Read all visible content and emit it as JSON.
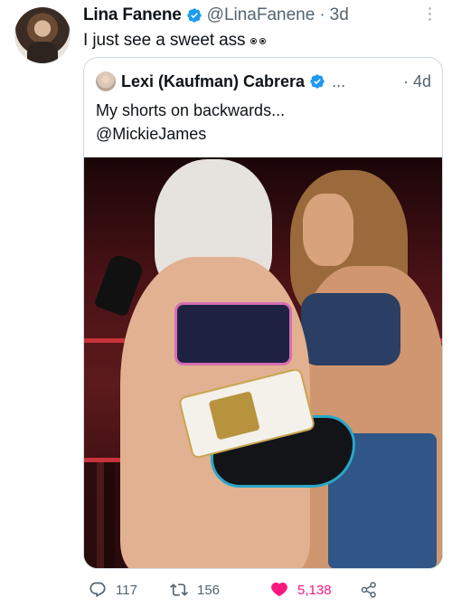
{
  "tweet": {
    "author": {
      "name": "Lina Fanene",
      "handle": "@LinaFanene",
      "separator": "·",
      "time": "3d"
    },
    "text": "I just see a sweet ass",
    "text_emoji": "eyes-emoji"
  },
  "quoted_tweet": {
    "author": {
      "name": "Lexi (Kaufman) Cabrera",
      "ellipsis": "...",
      "time": "· 4d"
    },
    "text_line1": "My shorts on backwards...",
    "text_line2": "@MickieJames"
  },
  "actions": {
    "reply": {
      "icon": "reply-icon",
      "count": "117"
    },
    "retweet": {
      "icon": "retweet-icon",
      "count": "156"
    },
    "like": {
      "icon": "heart-icon",
      "count": "5,138",
      "color": "#f91880"
    },
    "share": {
      "icon": "share-icon"
    }
  },
  "colors": {
    "verified": "#1d9bf0",
    "secondary_text": "#536471",
    "border": "#cfd9de"
  }
}
